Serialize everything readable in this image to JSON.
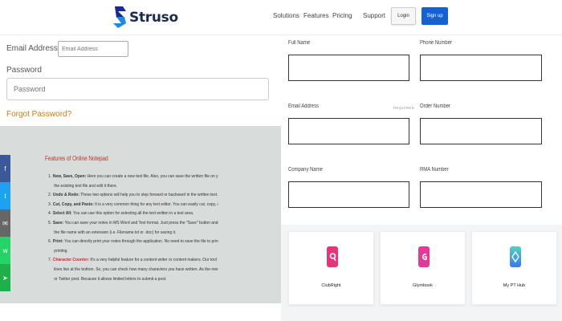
{
  "brand": {
    "name": "Struso",
    "color": "#1e5bd8"
  },
  "nav": {
    "links": [
      "Solutions",
      "Features",
      "Pricing",
      "Support"
    ],
    "login": "Login",
    "signup": "Sign up"
  },
  "login_form": {
    "email_label": "Email Address",
    "email_placeholder": "Email Address",
    "password_label": "Password",
    "password_placeholder": "Password",
    "forgot": "Forgot Password?"
  },
  "notepad": {
    "title": "Features of Online Notepad",
    "items": [
      {
        "num": "1.",
        "head": "New, Save, Open:",
        "text": " Here you can create a new text file. Also, you can save the written file on your PC or mobile. In addition, you can open",
        "red": false
      },
      {
        "num": "",
        "head": "",
        "text": "the existing text file and edit it there.",
        "red": false
      },
      {
        "num": "2.",
        "head": "Undo & Redo:",
        "text": " These two options will help you to step forward or backward in the written text.",
        "red": false
      },
      {
        "num": "3.",
        "head": "Cut, Copy, and Paste:",
        "text": " It is a very common thing for any text editor. You can easily cut, copy, or paste texts within our tool.",
        "red": false
      },
      {
        "num": "4.",
        "head": "Select All:",
        "text": " You can use this option for selecting all the text written in a text area.",
        "red": false
      },
      {
        "num": "5.",
        "head": "Save:",
        "text": " You can save your notes in MS Word and Text format. Just press the \"Save\" button and it will ask for the file name. So, you can give",
        "red": false
      },
      {
        "num": "",
        "head": "",
        "text": "the file name with an extension (i.e. Filename.txt or .doc) for saving it.",
        "red": false
      },
      {
        "num": "6.",
        "head": "Print:",
        "text": " You can directly print your notes through the application. No need to save the file to print. Just click on the \"Print\" button and start",
        "red": false
      },
      {
        "num": "",
        "head": "",
        "text": "printing.",
        "red": false
      },
      {
        "num": "7.",
        "head": "Character Counter:",
        "text": " It's a very helpful feature for a content writer or content makers. Our tool will count and show the number of characters and",
        "red": true
      },
      {
        "num": "",
        "head": "",
        "text": "lines live at the bottom. So, you can check how many characters you have written. As the meme, it is very useful when you write a facebook",
        "red": false
      },
      {
        "num": "",
        "head": "",
        "text": "or Twitter post. Because it allows limited letters to submit a post.",
        "red": false
      }
    ]
  },
  "social": [
    {
      "icon": "facebook-icon",
      "glyph": "f",
      "color": "#3b5998"
    },
    {
      "icon": "twitter-icon",
      "glyph": "t",
      "color": "#1da1f2"
    },
    {
      "icon": "email-icon",
      "glyph": "✉",
      "color": "#666666"
    },
    {
      "icon": "whatsapp-icon",
      "glyph": "w",
      "color": "#25d366"
    },
    {
      "icon": "share-icon",
      "glyph": "➤",
      "color": "#20b04b"
    }
  ],
  "contact_form": {
    "full_name": "Full Name",
    "phone": "Phone Number",
    "email": "Email Address",
    "required": "REQUIRED",
    "order": "Order Number",
    "company": "Company Name",
    "rma": "RMA Number"
  },
  "apps": [
    {
      "name": "ClubRight",
      "color": "#e6347a"
    },
    {
      "name": "Glymbook",
      "color": "#e23a98"
    },
    {
      "name": "My PT Hub",
      "color": "#3ab6e8"
    }
  ]
}
